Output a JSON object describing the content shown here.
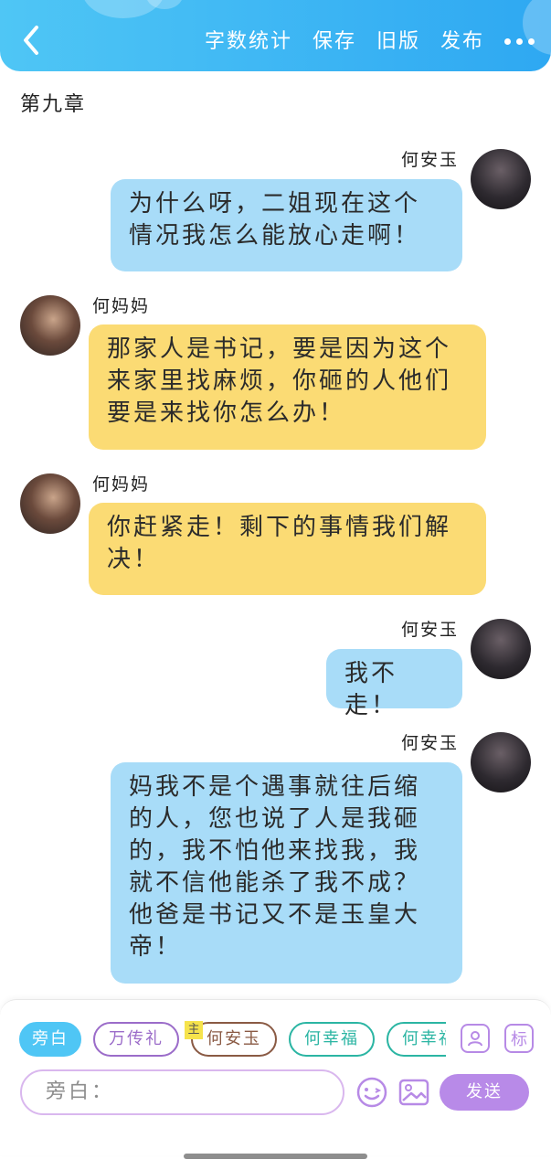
{
  "header": {
    "actions": [
      "字数统计",
      "保存",
      "旧版",
      "发布"
    ]
  },
  "chapter_title": "第九章",
  "messages": [
    {
      "speaker": "何安玉",
      "side": "right",
      "bubble_color": "#a8dcf8",
      "text": "为什么呀，二姐现在这个情况我怎么能放心走啊！"
    },
    {
      "speaker": "何妈妈",
      "side": "left",
      "bubble_color": "#fbdb74",
      "text": "那家人是书记，要是因为这个来家里找麻烦，你砸的人他们要是来找你怎么办！"
    },
    {
      "speaker": "何妈妈",
      "side": "left",
      "bubble_color": "#fbdb74",
      "text": "你赶紧走！剩下的事情我们解决！"
    },
    {
      "speaker": "何安玉",
      "side": "right",
      "bubble_color": "#a8dcf8",
      "text": "我不走！"
    },
    {
      "speaker": "何安玉",
      "side": "right",
      "bubble_color": "#a8dcf8",
      "text": "妈我不是个遇事就往后缩的人，您也说了人是我砸的，我不怕他来找我，我就不信他能杀了我不成？他爸是书记又不是玉皇大帝！"
    }
  ],
  "composer": {
    "chips": [
      {
        "label": "旁白",
        "color": "#4fc6f5",
        "filled": true
      },
      {
        "label": "万传礼",
        "color": "#9b6cc9",
        "filled": false
      },
      {
        "label": "何安玉",
        "color": "#8a5a44",
        "filled": false
      },
      {
        "label": "何幸福",
        "color": "#2bb5a3",
        "filled": false
      },
      {
        "label": "何幸福",
        "color": "#2bb5a3",
        "filled": false
      }
    ],
    "main_tag": "主",
    "side_icons": [
      "person-icon",
      "标"
    ],
    "input_placeholder": "旁白：",
    "send_label": "发送",
    "tool_icons": [
      "emoji-icon",
      "image-icon"
    ]
  },
  "colors": {
    "accent": "#2ea8f2",
    "purple": "#b88ae8"
  }
}
